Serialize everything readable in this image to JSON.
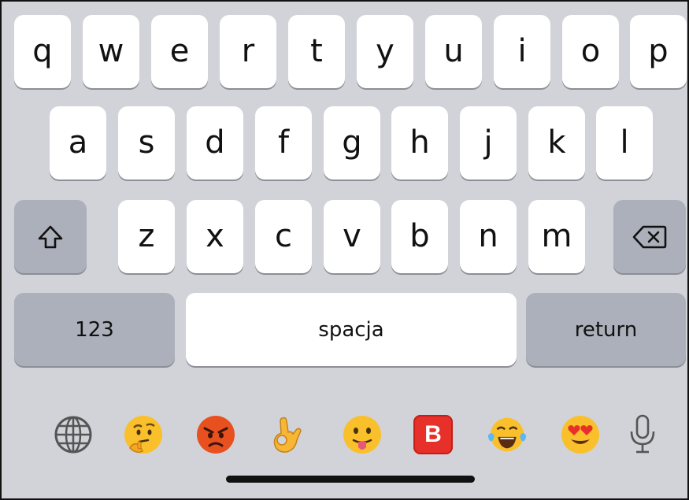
{
  "keyboard": {
    "row1": [
      "q",
      "w",
      "e",
      "r",
      "t",
      "y",
      "u",
      "i",
      "o",
      "p"
    ],
    "row2": [
      "a",
      "s",
      "d",
      "f",
      "g",
      "h",
      "j",
      "k",
      "l"
    ],
    "row3": [
      "z",
      "x",
      "c",
      "v",
      "b",
      "n",
      "m"
    ],
    "numbers_label": "123",
    "space_label": "spacja",
    "return_label": "return",
    "shift_icon": "shift-icon",
    "backspace_icon": "backspace-icon"
  },
  "bottom_bar": {
    "items": [
      "globe-icon",
      "thinking-face-emoji",
      "angry-face-emoji",
      "ok-hand-emoji",
      "tongue-face-emoji",
      "b-button-emoji",
      "tears-of-joy-emoji",
      "heart-eyes-emoji",
      "microphone-icon"
    ],
    "b_button_label": "B"
  },
  "colors": {
    "keyboard_bg": "#d1d3d9",
    "key_bg": "#ffffff",
    "special_key_bg": "#abb0ba"
  }
}
